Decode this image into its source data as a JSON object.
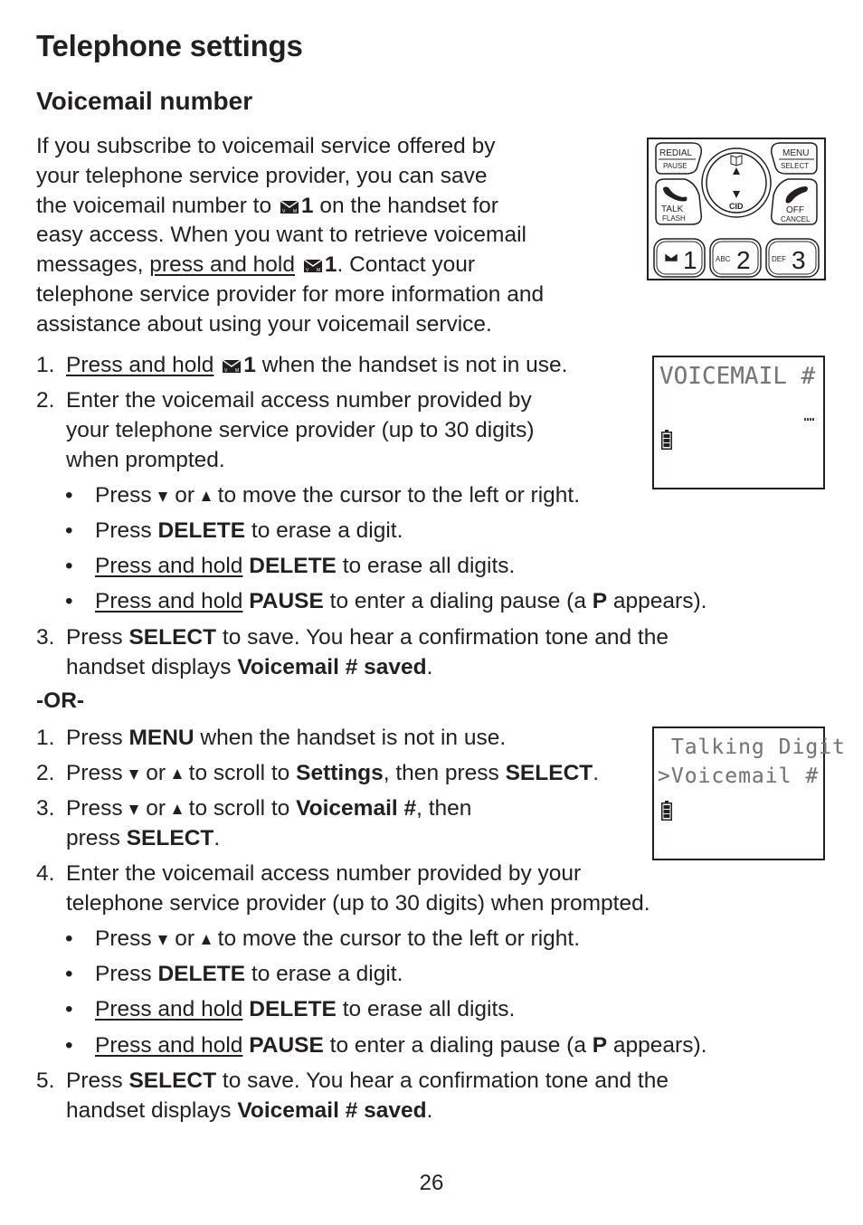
{
  "page": {
    "title": "Telephone settings",
    "section_title": "Voicemail number",
    "page_number": "26"
  },
  "intro": {
    "lines": [
      [
        "If you subscribe to voicemail service offered by"
      ],
      [
        "your telephone service provider, you can save"
      ],
      [
        "the voicemail number to ",
        {
          "icon": "voicemail-key"
        },
        {
          "b": "1"
        },
        " on the handset for"
      ],
      [
        "easy access. When you want to retrieve voicemail"
      ],
      [
        "messages, ",
        {
          "u": "press and hold"
        },
        " ",
        {
          "icon": "voicemail-key"
        },
        {
          "b": "1"
        },
        ". Contact your"
      ],
      [
        "telephone service provider for more information and"
      ],
      [
        "assistance about using your voicemail service."
      ]
    ]
  },
  "method1": {
    "steps": [
      {
        "type": "num",
        "marker": "1.",
        "lines": [
          [
            {
              "u": "Press and hold"
            },
            " ",
            {
              "icon": "voicemail-key"
            },
            {
              "b": "1"
            },
            " when the handset is not in use."
          ]
        ]
      },
      {
        "type": "num",
        "marker": "2.",
        "lines": [
          [
            "Enter the voicemail access number provided by"
          ],
          [
            "your telephone service provider (up to 30 digits)"
          ],
          [
            "when prompted."
          ]
        ]
      },
      {
        "type": "bullet",
        "marker": "•",
        "lines": [
          [
            "Press ",
            {
              "icon": "down-arrow"
            },
            " or ",
            {
              "icon": "up-arrow"
            },
            " to move the cursor to the left or right."
          ]
        ]
      },
      {
        "type": "bullet",
        "marker": "•",
        "lines": [
          [
            "Press ",
            {
              "b": "DELETE"
            },
            " to erase a digit."
          ]
        ]
      },
      {
        "type": "bullet",
        "marker": "•",
        "lines": [
          [
            {
              "u": "Press and hold"
            },
            " ",
            {
              "b": "DELETE"
            },
            " to erase all digits."
          ]
        ]
      },
      {
        "type": "bullet",
        "marker": "•",
        "lines": [
          [
            {
              "u": "Press and hold"
            },
            " ",
            {
              "b": "PAUSE"
            },
            " to enter a dialing pause (a ",
            {
              "b": "P"
            },
            " appears)."
          ]
        ]
      },
      {
        "type": "num",
        "marker": "3.",
        "lines": [
          [
            "Press ",
            {
              "b": "SELECT"
            },
            " to save. You hear a confirmation tone and the"
          ],
          [
            "handset displays ",
            {
              "b": "Voicemail # saved"
            },
            "."
          ]
        ]
      }
    ]
  },
  "separator": "-OR-",
  "method2": {
    "steps": [
      {
        "type": "num",
        "marker": "1.",
        "lines": [
          [
            "Press ",
            {
              "b": "MENU"
            },
            " when the handset is not in use."
          ]
        ]
      },
      {
        "type": "num",
        "marker": "2.",
        "lines": [
          [
            "Press ",
            {
              "icon": "down-arrow"
            },
            " or ",
            {
              "icon": "up-arrow"
            },
            " to scroll to ",
            {
              "b": "Settings"
            },
            ", then press ",
            {
              "b": "SELECT"
            },
            "."
          ]
        ]
      },
      {
        "type": "num",
        "marker": "3.",
        "lines": [
          [
            "Press ",
            {
              "icon": "down-arrow"
            },
            " or ",
            {
              "icon": "up-arrow"
            },
            " to scroll to ",
            {
              "b": "Voicemail #"
            },
            ", then"
          ],
          [
            "press ",
            {
              "b": "SELECT"
            },
            "."
          ]
        ]
      },
      {
        "type": "num",
        "marker": "4.",
        "lines": [
          [
            "Enter the voicemail access number provided by your"
          ],
          [
            "telephone service provider (up to 30 digits) when prompted."
          ]
        ]
      },
      {
        "type": "bullet",
        "marker": "•",
        "lines": [
          [
            "Press ",
            {
              "icon": "down-arrow"
            },
            " or ",
            {
              "icon": "up-arrow"
            },
            " to move the cursor to the left or right."
          ]
        ]
      },
      {
        "type": "bullet",
        "marker": "•",
        "lines": [
          [
            "Press ",
            {
              "b": "DELETE"
            },
            " to erase a digit."
          ]
        ]
      },
      {
        "type": "bullet",
        "marker": "•",
        "lines": [
          [
            {
              "u": "Press and hold"
            },
            " ",
            {
              "b": "DELETE"
            },
            " to erase all digits."
          ]
        ]
      },
      {
        "type": "bullet",
        "marker": "•",
        "lines": [
          [
            {
              "u": "Press and hold"
            },
            " ",
            {
              "b": "PAUSE"
            },
            " to enter a dialing pause (a ",
            {
              "b": "P"
            },
            " appears)."
          ]
        ]
      },
      {
        "type": "num",
        "marker": "5.",
        "lines": [
          [
            "Press ",
            {
              "b": "SELECT"
            },
            " to save. You hear a confirmation tone and the"
          ],
          [
            "handset displays ",
            {
              "b": "Voicemail # saved"
            },
            "."
          ]
        ]
      }
    ]
  },
  "keypad": {
    "redial": "REDIAL",
    "pause": "PAUSE",
    "menu": "MENU",
    "select": "SELECT",
    "talk": "TALK",
    "flash": "FLASH",
    "off": "OFF",
    "cancel": "CANCEL",
    "cid": "CID",
    "key1": "1",
    "key2": "2",
    "key2_letters": "ABC",
    "key3": "3",
    "key3_letters": "DEF"
  },
  "screen1": {
    "line1": "VOICEMAIL #"
  },
  "screen2": {
    "line1": " Talking Digit",
    "line2": ">Voicemail #"
  }
}
